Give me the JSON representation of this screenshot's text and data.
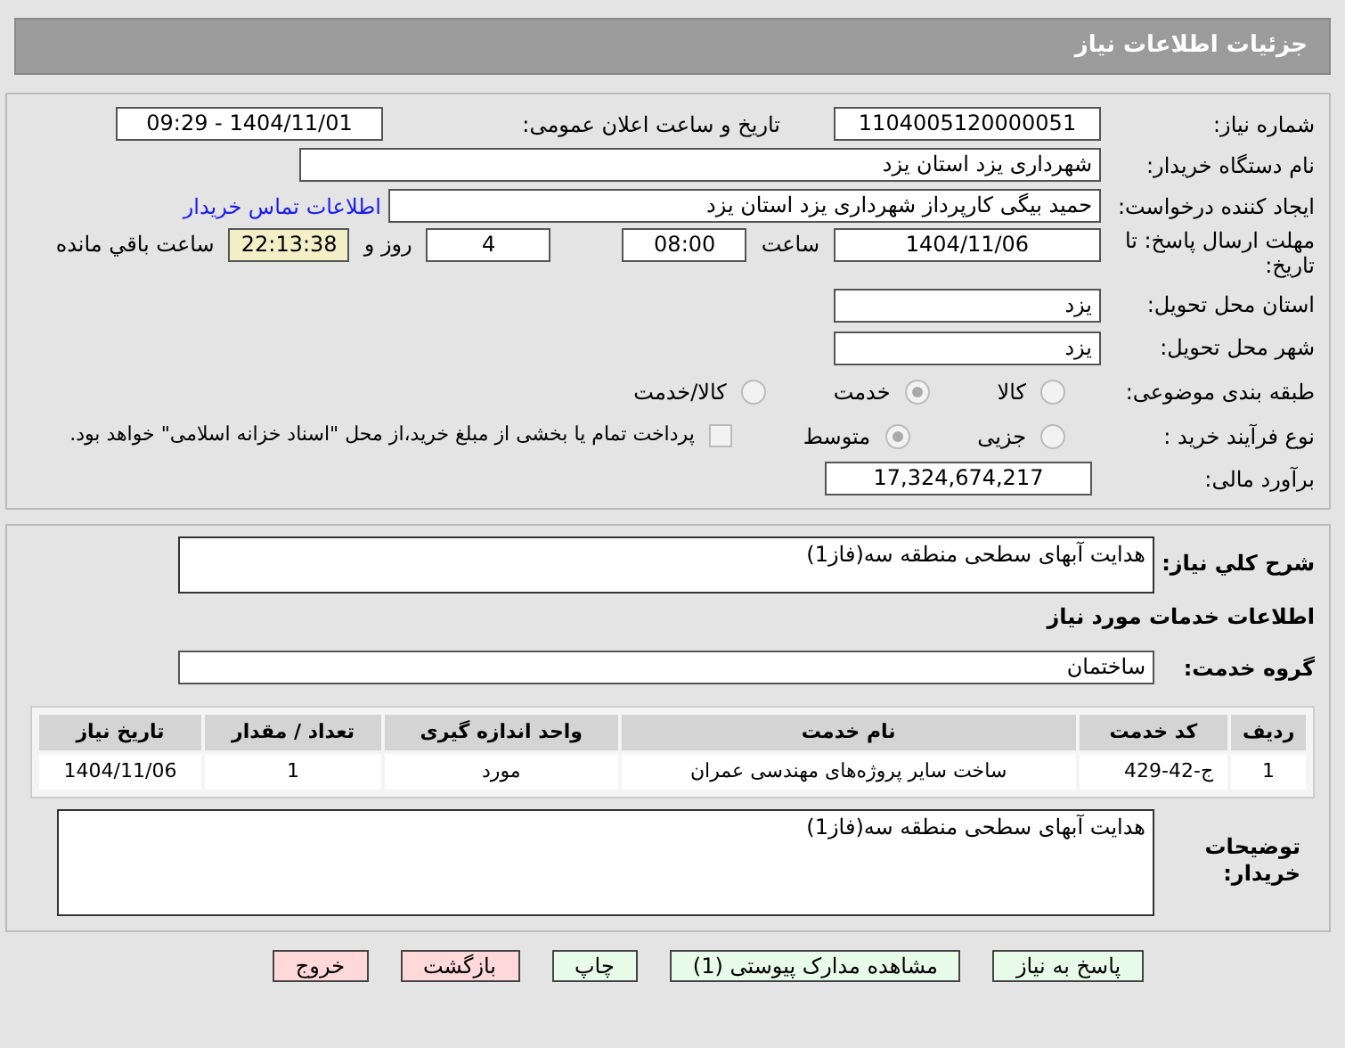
{
  "title": "جزئیات اطلاعات نیاز",
  "need_number": {
    "label": "شماره نیاز:",
    "value": "1104005120000051"
  },
  "announce": {
    "label": "تاریخ و ساعت اعلان عمومی:",
    "value": "1404/11/01 - 09:29"
  },
  "buyer_org": {
    "label": "نام دستگاه خریدار:",
    "value": "شهرداری یزد استان یزد"
  },
  "requester": {
    "label": "ایجاد کننده درخواست:",
    "value": "حمید بیگی کارپرداز شهرداری یزد استان یزد",
    "link": "اطلاعات تماس خریدار"
  },
  "deadline": {
    "label": "مهلت ارسال پاسخ: تا تاریخ:",
    "date": "1404/11/06",
    "time_label": "ساعت",
    "time": "08:00",
    "days": "4",
    "days_label": "روز و",
    "remaining": "22:13:38",
    "remaining_label": "ساعت باقي مانده"
  },
  "province": {
    "label": "استان محل تحویل:",
    "value": "یزد"
  },
  "city": {
    "label": "شهر محل تحویل:",
    "value": "یزد"
  },
  "category": {
    "label": "طبقه بندی موضوعی:",
    "options": [
      {
        "label": "کالا",
        "selected": false
      },
      {
        "label": "خدمت",
        "selected": true
      },
      {
        "label": "کالا/خدمت",
        "selected": false
      }
    ]
  },
  "process": {
    "label": "نوع فرآیند خرید :",
    "options": [
      {
        "label": "جزیی",
        "selected": false
      },
      {
        "label": "متوسط",
        "selected": true
      }
    ],
    "checkbox": {
      "label": "پرداخت تمام یا بخشی از مبلغ خرید،از محل \"اسناد خزانه اسلامی\" خواهد بود.",
      "checked": false
    }
  },
  "budget": {
    "label": "برآورد مالی:",
    "value": "17,324,674,217"
  },
  "description": {
    "label": "شرح کلي نیاز:",
    "value": "هدایت آبهای سطحی منطقه سه(فاز1)"
  },
  "services_heading": "اطلاعات خدمات مورد نیاز",
  "service_group": {
    "label": "گروه خدمت:",
    "value": "ساختمان"
  },
  "table": {
    "columns": [
      "ردیف",
      "کد خدمت",
      "نام خدمت",
      "واحد اندازه گیری",
      "تعداد / مقدار",
      "تاریخ نیاز"
    ],
    "rows": [
      [
        "1",
        "ج-42-429",
        "ساخت سایر پروژه‌های مهندسی عمران",
        "مورد",
        "1",
        "1404/11/06"
      ]
    ]
  },
  "notes": {
    "label": "توضیحات خریدار:",
    "value": "هدایت آبهای سطحی منطقه سه(فاز1)"
  },
  "buttons": [
    {
      "label": "پاسخ به نیاز",
      "kind": "normal"
    },
    {
      "label": "مشاهده مدارک پیوستی (1)",
      "kind": "normal"
    },
    {
      "label": "چاپ",
      "kind": "normal"
    },
    {
      "label": "بازگشت",
      "kind": "danger"
    },
    {
      "label": "خروج",
      "kind": "danger"
    }
  ]
}
